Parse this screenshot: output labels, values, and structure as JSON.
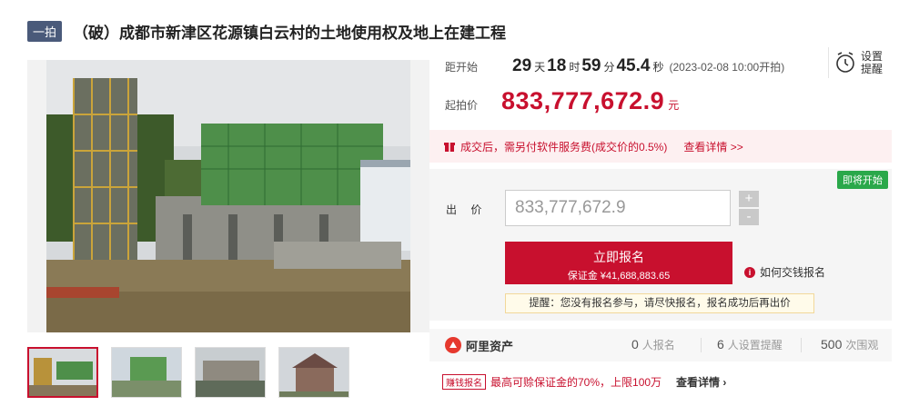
{
  "title": {
    "tag": "一拍",
    "text": "（破）成都市新津区花源镇白云村的土地使用权及地上在建工程"
  },
  "countdown": {
    "label": "距开始",
    "days": "29",
    "days_unit": "天",
    "hours": "18",
    "hours_unit": "时",
    "minutes": "59",
    "minutes_unit": "分",
    "seconds": "45.4",
    "seconds_unit": "秒",
    "start_time": "(2023-02-08 10:00开拍)"
  },
  "remind": {
    "line1": "设置",
    "line2": "提醒",
    "icon": "alarm-clock-icon"
  },
  "price": {
    "label": "起拍价",
    "value": "833,777,672.9",
    "unit": "元"
  },
  "fee": {
    "text": "成交后，需另付软件服务费(成交价的0.5%)",
    "link": "查看详情 >>"
  },
  "bid": {
    "status_tag": "即将开始",
    "label": "出 价",
    "input_value": "833,777,672.9",
    "plus": "+",
    "minus": "-",
    "apply_button": "立即报名",
    "deposit": "保证金 ¥41,688,883.65",
    "how_to": "如何交钱报名",
    "tip": "提醒：您没有报名参与，请尽快报名，报名成功后再出价"
  },
  "stats": {
    "brand": "阿里资产",
    "signup_count": "0",
    "signup_label": "人报名",
    "remind_count": "6",
    "remind_label": "人设置提醒",
    "view_count": "500",
    "view_label": "次围观"
  },
  "deposit_loan": {
    "tag": "赚钱报名",
    "text": "最高可赊保证金的70%，上限100万",
    "link": "查看详情"
  },
  "colors": {
    "accent": "#c8102e",
    "green_tag": "#2aa84a",
    "title_tag": "#4a5a7a"
  }
}
